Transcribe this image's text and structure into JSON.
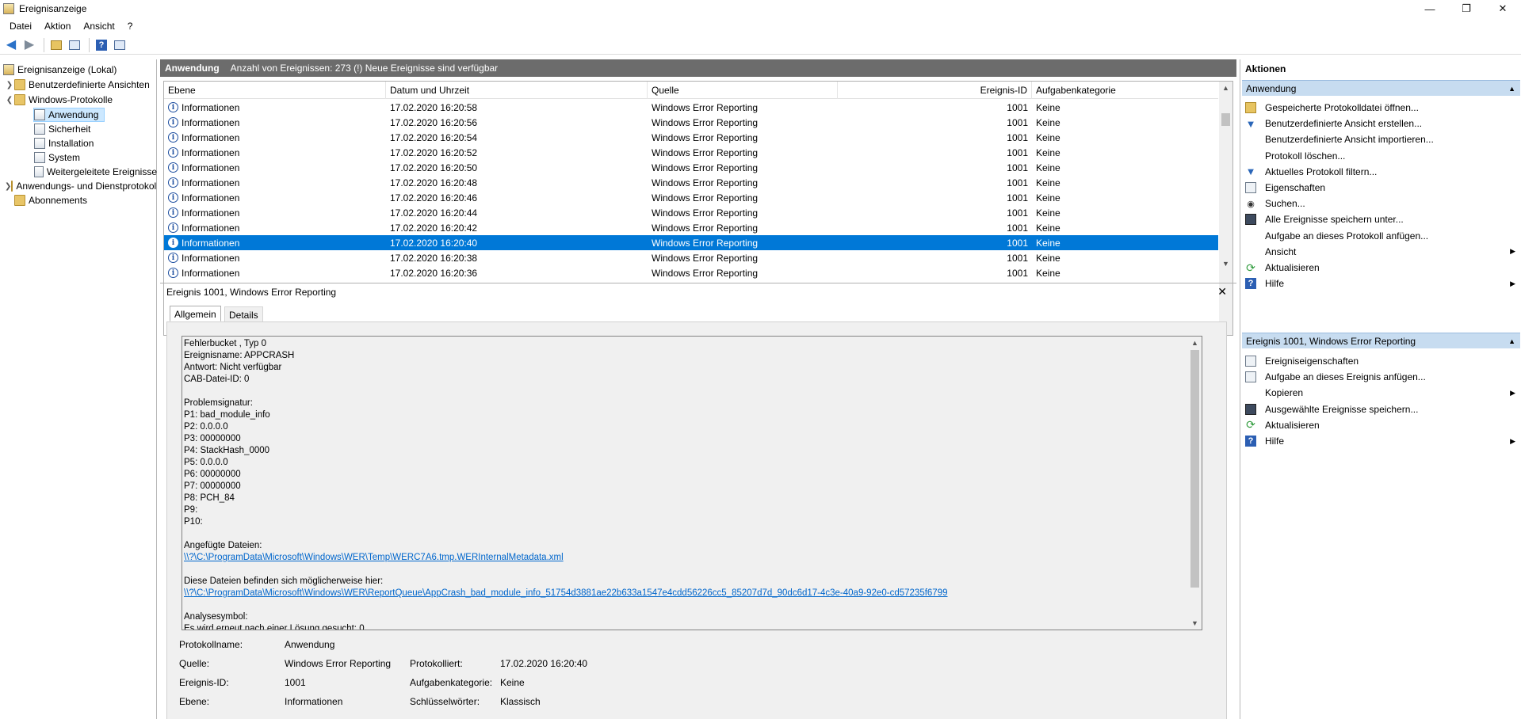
{
  "window": {
    "title": "Ereignisanzeige",
    "controls": [
      "—",
      "❐",
      "✕"
    ]
  },
  "menu": [
    "Datei",
    "Aktion",
    "Ansicht",
    "?"
  ],
  "tree": {
    "root": "Ereignisanzeige (Lokal)",
    "custom_views": "Benutzerdefinierte Ansichten",
    "windows_logs": "Windows-Protokolle",
    "logs": [
      "Anwendung",
      "Sicherheit",
      "Installation",
      "System",
      "Weitergeleitete Ereignisse"
    ],
    "app_services": "Anwendungs- und Dienstprotokolle",
    "subscriptions": "Abonnements"
  },
  "center": {
    "header_title": "Anwendung",
    "header_info": "Anzahl von Ereignissen: 273 (!) Neue Ereignisse sind verfügbar"
  },
  "table": {
    "columns": [
      "Ebene",
      "Datum und Uhrzeit",
      "Quelle",
      "Ereignis-ID",
      "Aufgabenkategorie"
    ],
    "rows": [
      {
        "level": "Informationen",
        "date": "17.02.2020 16:20:58",
        "source": "Windows Error Reporting",
        "id": "1001",
        "category": "Keine"
      },
      {
        "level": "Informationen",
        "date": "17.02.2020 16:20:56",
        "source": "Windows Error Reporting",
        "id": "1001",
        "category": "Keine"
      },
      {
        "level": "Informationen",
        "date": "17.02.2020 16:20:54",
        "source": "Windows Error Reporting",
        "id": "1001",
        "category": "Keine"
      },
      {
        "level": "Informationen",
        "date": "17.02.2020 16:20:52",
        "source": "Windows Error Reporting",
        "id": "1001",
        "category": "Keine"
      },
      {
        "level": "Informationen",
        "date": "17.02.2020 16:20:50",
        "source": "Windows Error Reporting",
        "id": "1001",
        "category": "Keine"
      },
      {
        "level": "Informationen",
        "date": "17.02.2020 16:20:48",
        "source": "Windows Error Reporting",
        "id": "1001",
        "category": "Keine"
      },
      {
        "level": "Informationen",
        "date": "17.02.2020 16:20:46",
        "source": "Windows Error Reporting",
        "id": "1001",
        "category": "Keine"
      },
      {
        "level": "Informationen",
        "date": "17.02.2020 16:20:44",
        "source": "Windows Error Reporting",
        "id": "1001",
        "category": "Keine"
      },
      {
        "level": "Informationen",
        "date": "17.02.2020 16:20:42",
        "source": "Windows Error Reporting",
        "id": "1001",
        "category": "Keine"
      },
      {
        "level": "Informationen",
        "date": "17.02.2020 16:20:40",
        "source": "Windows Error Reporting",
        "id": "1001",
        "category": "Keine"
      },
      {
        "level": "Informationen",
        "date": "17.02.2020 16:20:38",
        "source": "Windows Error Reporting",
        "id": "1001",
        "category": "Keine"
      },
      {
        "level": "Informationen",
        "date": "17.02.2020 16:20:36",
        "source": "Windows Error Reporting",
        "id": "1001",
        "category": "Keine"
      }
    ],
    "selected_index": 9
  },
  "details": {
    "title": "Ereignis 1001, Windows Error Reporting",
    "tabs": [
      "Allgemein",
      "Details"
    ],
    "description_lines": [
      "Fehlerbucket , Typ 0",
      "Ereignisname: APPCRASH",
      "Antwort: Nicht verfügbar",
      "CAB-Datei-ID: 0",
      "",
      "Problemsignatur:",
      "P1: bad_module_info",
      "P2: 0.0.0.0",
      "P3: 00000000",
      "P4: StackHash_0000",
      "P5: 0.0.0.0",
      "P6: 00000000",
      "P7: 00000000",
      "P8: PCH_84",
      "P9:",
      "P10:",
      "",
      "Angefügte Dateien:",
      "\\\\?\\C:\\ProgramData\\Microsoft\\Windows\\WER\\Temp\\WERC7A6.tmp.WERInternalMetadata.xml",
      "",
      "Diese Dateien befinden sich möglicherweise hier:",
      "\\\\?\\C:\\ProgramData\\Microsoft\\Windows\\WER\\ReportQueue\\AppCrash_bad_module_info_51754d3881ae22b633a1547e4cdd56226cc5_85207d7d_90dc6d17-4c3e-40a9-92e0-cd57235f6799",
      "",
      "Analysesymbol:",
      "Es wird erneut nach einer Lösung gesucht: 0"
    ],
    "link_lines": [
      18,
      21
    ],
    "meta": {
      "log_name_label": "Protokollname:",
      "log_name": "Anwendung",
      "source_label": "Quelle:",
      "source": "Windows Error Reporting",
      "logged_label": "Protokolliert:",
      "logged": "17.02.2020 16:20:40",
      "event_id_label": "Ereignis-ID:",
      "event_id": "1001",
      "task_label": "Aufgabenkategorie:",
      "task": "Keine",
      "level_label": "Ebene:",
      "level": "Informationen",
      "keywords_label": "Schlüsselwörter:",
      "keywords": "Klassisch"
    }
  },
  "actions": {
    "title": "Aktionen",
    "section1": "Anwendung",
    "items1": [
      {
        "label": "Gespeicherte Protokolldatei öffnen...",
        "icon": "open-folder-icon",
        "more": false
      },
      {
        "label": "Benutzerdefinierte Ansicht erstellen...",
        "icon": "filter-icon",
        "more": false
      },
      {
        "label": "Benutzerdefinierte Ansicht importieren...",
        "icon": "",
        "more": false
      },
      {
        "label": "Protokoll löschen...",
        "icon": "",
        "more": false
      },
      {
        "label": "Aktuelles Protokoll filtern...",
        "icon": "filter-icon",
        "more": false
      },
      {
        "label": "Eigenschaften",
        "icon": "properties-icon",
        "more": false
      },
      {
        "label": "Suchen...",
        "icon": "find-icon",
        "more": false
      },
      {
        "label": "Alle Ereignisse speichern unter...",
        "icon": "save-icon",
        "more": false
      },
      {
        "label": "Aufgabe an dieses Protokoll anfügen...",
        "icon": "",
        "more": false
      },
      {
        "label": "Ansicht",
        "icon": "",
        "more": true
      },
      {
        "label": "Aktualisieren",
        "icon": "refresh-icon",
        "more": false
      },
      {
        "label": "Hilfe",
        "icon": "help-icon",
        "more": true
      }
    ],
    "section2": "Ereignis 1001, Windows Error Reporting",
    "items2": [
      {
        "label": "Ereigniseigenschaften",
        "icon": "properties-icon",
        "more": false
      },
      {
        "label": "Aufgabe an dieses Ereignis anfügen...",
        "icon": "task-icon",
        "more": false
      },
      {
        "label": "Kopieren",
        "icon": "",
        "more": true
      },
      {
        "label": "Ausgewählte Ereignisse speichern...",
        "icon": "save-icon",
        "more": false
      },
      {
        "label": "Aktualisieren",
        "icon": "refresh-icon",
        "more": false
      },
      {
        "label": "Hilfe",
        "icon": "help-icon",
        "more": true
      }
    ]
  }
}
